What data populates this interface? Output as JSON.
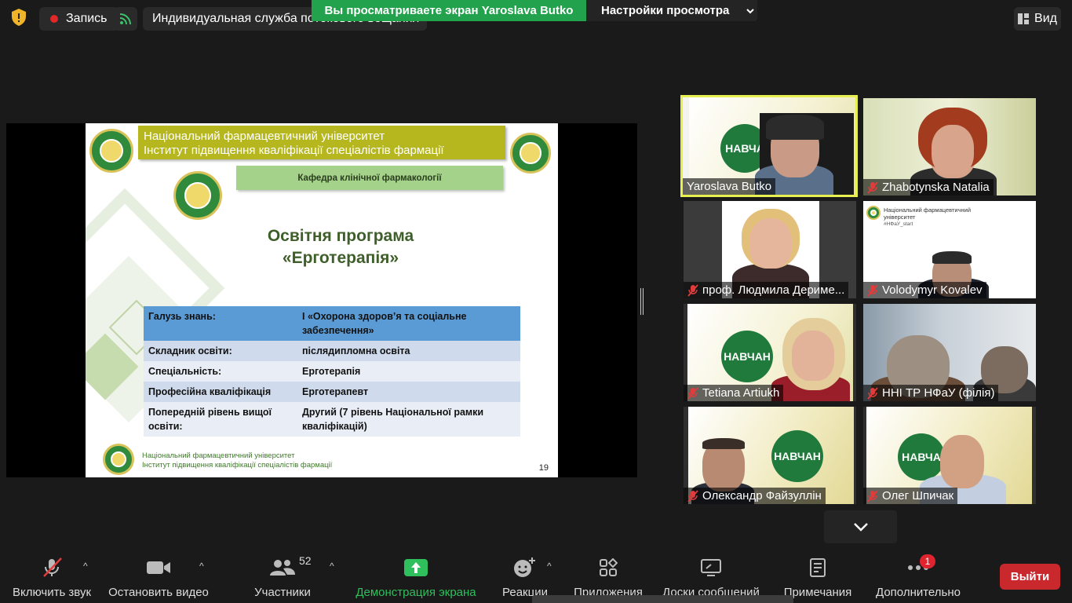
{
  "topbar": {
    "record_label": "Запись",
    "stream_label": "Индивидуальная служба потокового вещания",
    "share_banner": "Вы просматриваете экран Yaroslava Butko",
    "view_settings": "Настройки просмотра",
    "view_label": "Вид"
  },
  "slide": {
    "university_line1": "Національний фармацевтичний університет",
    "university_line2": "Інститут підвищення кваліфікації спеціалістів фармації",
    "department": "Кафедра клінічної фармакології",
    "title_line1": "Освітня програма",
    "title_line2": "«Ерготерапія»",
    "table": [
      [
        "Галузь знань:",
        "І «Охорона здоров’я та соціальне забезпечення»"
      ],
      [
        "Складник освіти:",
        "післядипломна освіта"
      ],
      [
        "Спеціальність:",
        "Ерготерапія"
      ],
      [
        "Професійна кваліфікація",
        "Ерготерапевт"
      ],
      [
        "Попередній рівень вищої освіти:",
        "Другий (7 рівень Національної рамки кваліфікацій)"
      ]
    ],
    "footer_line1": "Національний фармацевтичний університет",
    "footer_line2": "Інститут підвищення кваліфікації спеціалістів фармації",
    "page_number": "19"
  },
  "participants": [
    {
      "name": "Yaroslava Butko",
      "muted": false,
      "active": true
    },
    {
      "name": "Zhabotynska Natalia",
      "muted": true
    },
    {
      "name": "проф. Людмила Дериме...",
      "muted": true
    },
    {
      "name": "Volodymyr Kovalev",
      "muted": true
    },
    {
      "name": "Tetiana Artiukh",
      "muted": true
    },
    {
      "name": "ННІ ТР НФаУ (філія)",
      "muted": true
    },
    {
      "name": "Олександр Файзуллін",
      "muted": true
    },
    {
      "name": "Олег Шпичак",
      "muted": true
    }
  ],
  "tile_text": {
    "navch": "НАВЧА",
    "navchan": "НАВЧАН",
    "kovalev_line1": "Національний фармацевтичний",
    "kovalev_line2": "університет",
    "kovalev_tag": "#НФаУ_start"
  },
  "toolbar": {
    "audio": "Включить звук",
    "video": "Остановить видео",
    "participants": "Участники",
    "participants_count": "52",
    "share": "Демонстрация экрана",
    "reactions": "Реакции",
    "apps": "Приложения",
    "whiteboards": "Доски сообщений",
    "notes": "Примечания",
    "more": "Дополнительно",
    "more_badge": "1",
    "exit": "Выйти"
  },
  "colors": {
    "share_green": "#23a24d",
    "exit_red": "#c9282d",
    "active_speaker": "#e8ef50",
    "slide_olive": "#b6b71e"
  }
}
